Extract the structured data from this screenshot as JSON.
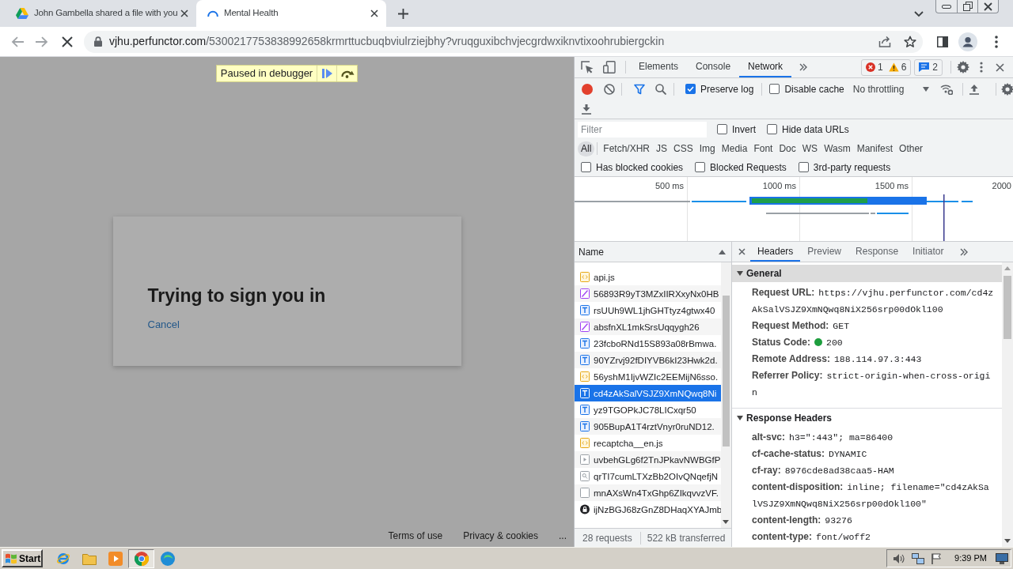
{
  "browser": {
    "tabs": [
      {
        "title": "John Gambella shared a file with you",
        "selected": false,
        "loading": false
      },
      {
        "title": "Mental Health",
        "selected": true,
        "loading": true
      }
    ],
    "page_loading": true,
    "url": {
      "host": "vjhu.perfunctor.com",
      "path": "/5300217753838992658krmrttucbuqbviulrziejbhy?vruqguxibchvjecgrdwxiknvtixoohrubiergckin"
    }
  },
  "page": {
    "debugger_banner": "Paused in debugger",
    "dialog": {
      "title": "Trying to sign you in",
      "cancel": "Cancel"
    },
    "footer_links": [
      "Terms of use",
      "Privacy & cookies",
      "..."
    ]
  },
  "devtools": {
    "panel_tabs": [
      {
        "label": "Elements",
        "selected": false
      },
      {
        "label": "Console",
        "selected": false
      },
      {
        "label": "Network",
        "selected": true
      }
    ],
    "issues": {
      "errors": "1",
      "warnings": "6",
      "messages": "2"
    },
    "recording": true,
    "toolbar_checkboxes": [
      {
        "label": "Preserve log",
        "checked": true
      },
      {
        "label": "Disable cache",
        "checked": false
      }
    ],
    "throttling": "No throttling",
    "filter": {
      "placeholder": "Filter"
    },
    "filter_checkboxes": [
      {
        "label": "Invert",
        "checked": false
      },
      {
        "label": "Hide data URLs",
        "checked": false
      }
    ],
    "type_filters": [
      {
        "label": "All",
        "selected": true
      },
      {
        "label": "Fetch/XHR",
        "selected": false
      },
      {
        "label": "JS",
        "selected": false
      },
      {
        "label": "CSS",
        "selected": false
      },
      {
        "label": "Img",
        "selected": false
      },
      {
        "label": "Media",
        "selected": false
      },
      {
        "label": "Font",
        "selected": false
      },
      {
        "label": "Doc",
        "selected": false
      },
      {
        "label": "WS",
        "selected": false
      },
      {
        "label": "Wasm",
        "selected": false
      },
      {
        "label": "Manifest",
        "selected": false
      },
      {
        "label": "Other",
        "selected": false
      }
    ],
    "extra_checkboxes": [
      {
        "label": "Has blocked cookies",
        "checked": false
      },
      {
        "label": "Blocked Requests",
        "checked": false
      },
      {
        "label": "3rd-party requests",
        "checked": false
      }
    ],
    "timeline": {
      "ticks": [
        "500 ms",
        "1000 ms",
        "1500 ms",
        "2000"
      ]
    },
    "requests": {
      "column": "Name",
      "rows": [
        {
          "name": "api.js",
          "kind": "script",
          "selected": false
        },
        {
          "name": "56893R9yT3MZxIIRXxyNx0HB",
          "kind": "image",
          "selected": false
        },
        {
          "name": "rsUUh9WL1jhGHTtyz4gtwx40",
          "kind": "font",
          "selected": false
        },
        {
          "name": "absfnXL1mkSrsUqqygh26",
          "kind": "image",
          "selected": false
        },
        {
          "name": "23fcboRNd15S893a08rBmwa.",
          "kind": "font",
          "selected": false
        },
        {
          "name": "90YZrvj92fDIYVB6kI23Hwk2d.",
          "kind": "font",
          "selected": false
        },
        {
          "name": "56yshM1IjvWZIc2EEMijN6sso.",
          "kind": "script",
          "selected": false
        },
        {
          "name": "cd4zAkSalVSJZ9XmNQwq8Ni",
          "kind": "font",
          "selected": true
        },
        {
          "name": "yz9TGOPkJC78LICxqr50",
          "kind": "font",
          "selected": false
        },
        {
          "name": "905BupA1T4rztVnyr0ruND12.",
          "kind": "font",
          "selected": false
        },
        {
          "name": "recaptcha__en.js",
          "kind": "script",
          "selected": false
        },
        {
          "name": "uvbehGLg6f2TnJPkavNWBGfP",
          "kind": "other",
          "selected": false
        },
        {
          "name": "qrTI7cumLTXzBb2OIvQNqefjN",
          "kind": "fetch",
          "selected": false
        },
        {
          "name": "mnAXsWn4TxGhp6ZIkqvvzVF.",
          "kind": "document",
          "selected": false
        },
        {
          "name": "ijNzBGJ68zGnZ8DHaqXYAJmb",
          "kind": "lock",
          "selected": false
        }
      ],
      "summary": [
        "28 requests",
        "522 kB transferred"
      ]
    },
    "details": {
      "tabs": [
        {
          "label": "Headers",
          "selected": true
        },
        {
          "label": "Preview",
          "selected": false
        },
        {
          "label": "Response",
          "selected": false
        },
        {
          "label": "Initiator",
          "selected": false
        }
      ],
      "sections": [
        {
          "title": "General",
          "selected": true,
          "expanded": true,
          "rows": [
            {
              "kind": "text",
              "name": "Request URL:",
              "value": "https://vjhu.perfunctor.com/cd4zAkSalVSJZ9XmNQwq8NiX256srp00dOkl100"
            },
            {
              "kind": "text",
              "name": "Request Method:",
              "value": "GET"
            },
            {
              "kind": "status",
              "name": "Status Code:",
              "value": "200"
            },
            {
              "kind": "text",
              "name": "Remote Address:",
              "value": "188.114.97.3:443"
            },
            {
              "kind": "text",
              "name": "Referrer Policy:",
              "value": "strict-origin-when-cross-origin"
            }
          ]
        },
        {
          "title": "Response Headers",
          "selected": false,
          "expanded": true,
          "rows": [
            {
              "kind": "text",
              "name": "alt-svc:",
              "value": "h3=\":443\"; ma=86400"
            },
            {
              "kind": "text",
              "name": "cf-cache-status:",
              "value": "DYNAMIC"
            },
            {
              "kind": "text",
              "name": "cf-ray:",
              "value": "8976cde8ad38caa5-HAM"
            },
            {
              "kind": "text",
              "name": "content-disposition:",
              "value": "inline; filename=\"cd4zAkSalVSJZ9XmNQwq8NiX256srp00dOkl100\""
            },
            {
              "kind": "text",
              "name": "content-length:",
              "value": "93276"
            },
            {
              "kind": "text",
              "name": "content-type:",
              "value": "font/woff2"
            }
          ]
        }
      ]
    }
  },
  "taskbar": {
    "start": "Start",
    "apps": [
      {
        "kind": "ie",
        "selected": false
      },
      {
        "kind": "folder",
        "selected": false
      },
      {
        "kind": "media",
        "selected": false
      },
      {
        "kind": "chrome",
        "selected": true
      },
      {
        "kind": "edge",
        "selected": false
      }
    ],
    "clock": "9:39 PM"
  }
}
